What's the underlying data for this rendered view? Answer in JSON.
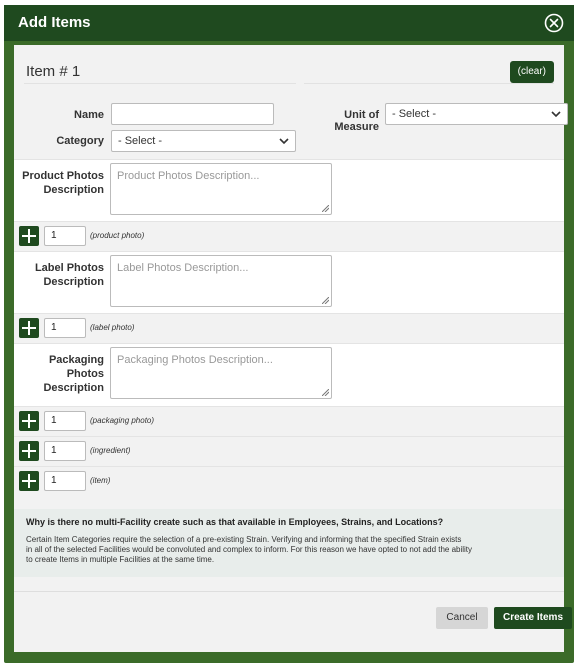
{
  "modal": {
    "title": "Add Items",
    "close_icon": "close-circle-icon"
  },
  "item": {
    "heading": "Item # 1",
    "clear_label": "(clear)"
  },
  "fields": {
    "name_label": "Name",
    "name_value": "",
    "uom_label": "Unit of Measure",
    "uom_selected": "- Select -",
    "category_label": "Category",
    "category_selected": "- Select -"
  },
  "product_photos": {
    "label": "Product Photos Description",
    "placeholder": "Product Photos Description...",
    "count": "1",
    "hint": "(product photo)"
  },
  "label_photos": {
    "label": "Label Photos Description",
    "placeholder": "Label Photos Description...",
    "count": "1",
    "hint": "(label photo)"
  },
  "packaging_photos": {
    "label": "Packaging Photos Description",
    "placeholder": "Packaging Photos Description...",
    "count": "1",
    "hint": "(packaging photo)"
  },
  "ingredient": {
    "count": "1",
    "hint": "(ingredient)"
  },
  "items_row": {
    "count": "1",
    "hint": "(item)"
  },
  "info": {
    "question": "Why is there no multi-Facility create such as that available in Employees, Strains, and Locations?",
    "answer": "Certain Item Categories require the selection of a pre-existing Strain. Verifying and informing that the specified Strain exists\nin all of the selected Facilities would be convoluted and complex to inform. For this reason we have opted to not add the ability\nto create Items in multiple Facilities at the same time."
  },
  "footer": {
    "cancel_label": "Cancel",
    "create_label": "Create Items"
  },
  "colors": {
    "accent": "#1f4a1f",
    "frame": "#3b6b29",
    "panel": "#f2f2f2"
  }
}
